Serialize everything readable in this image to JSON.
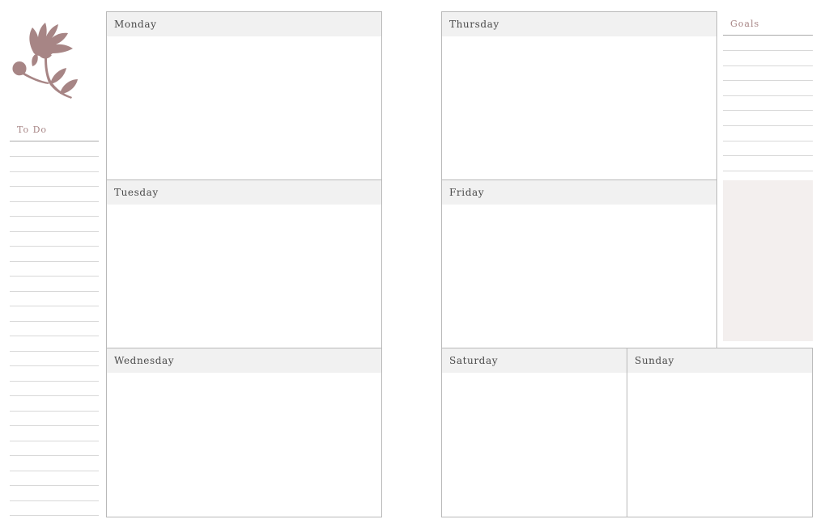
{
  "todo": {
    "label": "To Do",
    "line_count": 25
  },
  "goals": {
    "label": "Goals",
    "line_count": 9
  },
  "days": {
    "monday": "Monday",
    "tuesday": "Tuesday",
    "wednesday": "Wednesday",
    "thursday": "Thursday",
    "friday": "Friday",
    "saturday": "Saturday",
    "sunday": "Sunday"
  },
  "colors": {
    "accent": "#a78585",
    "header_band": "#f1f1f1",
    "notes_panel": "#f3efee",
    "border": "#b9b9b9"
  },
  "illustration": "protea-flower-icon"
}
